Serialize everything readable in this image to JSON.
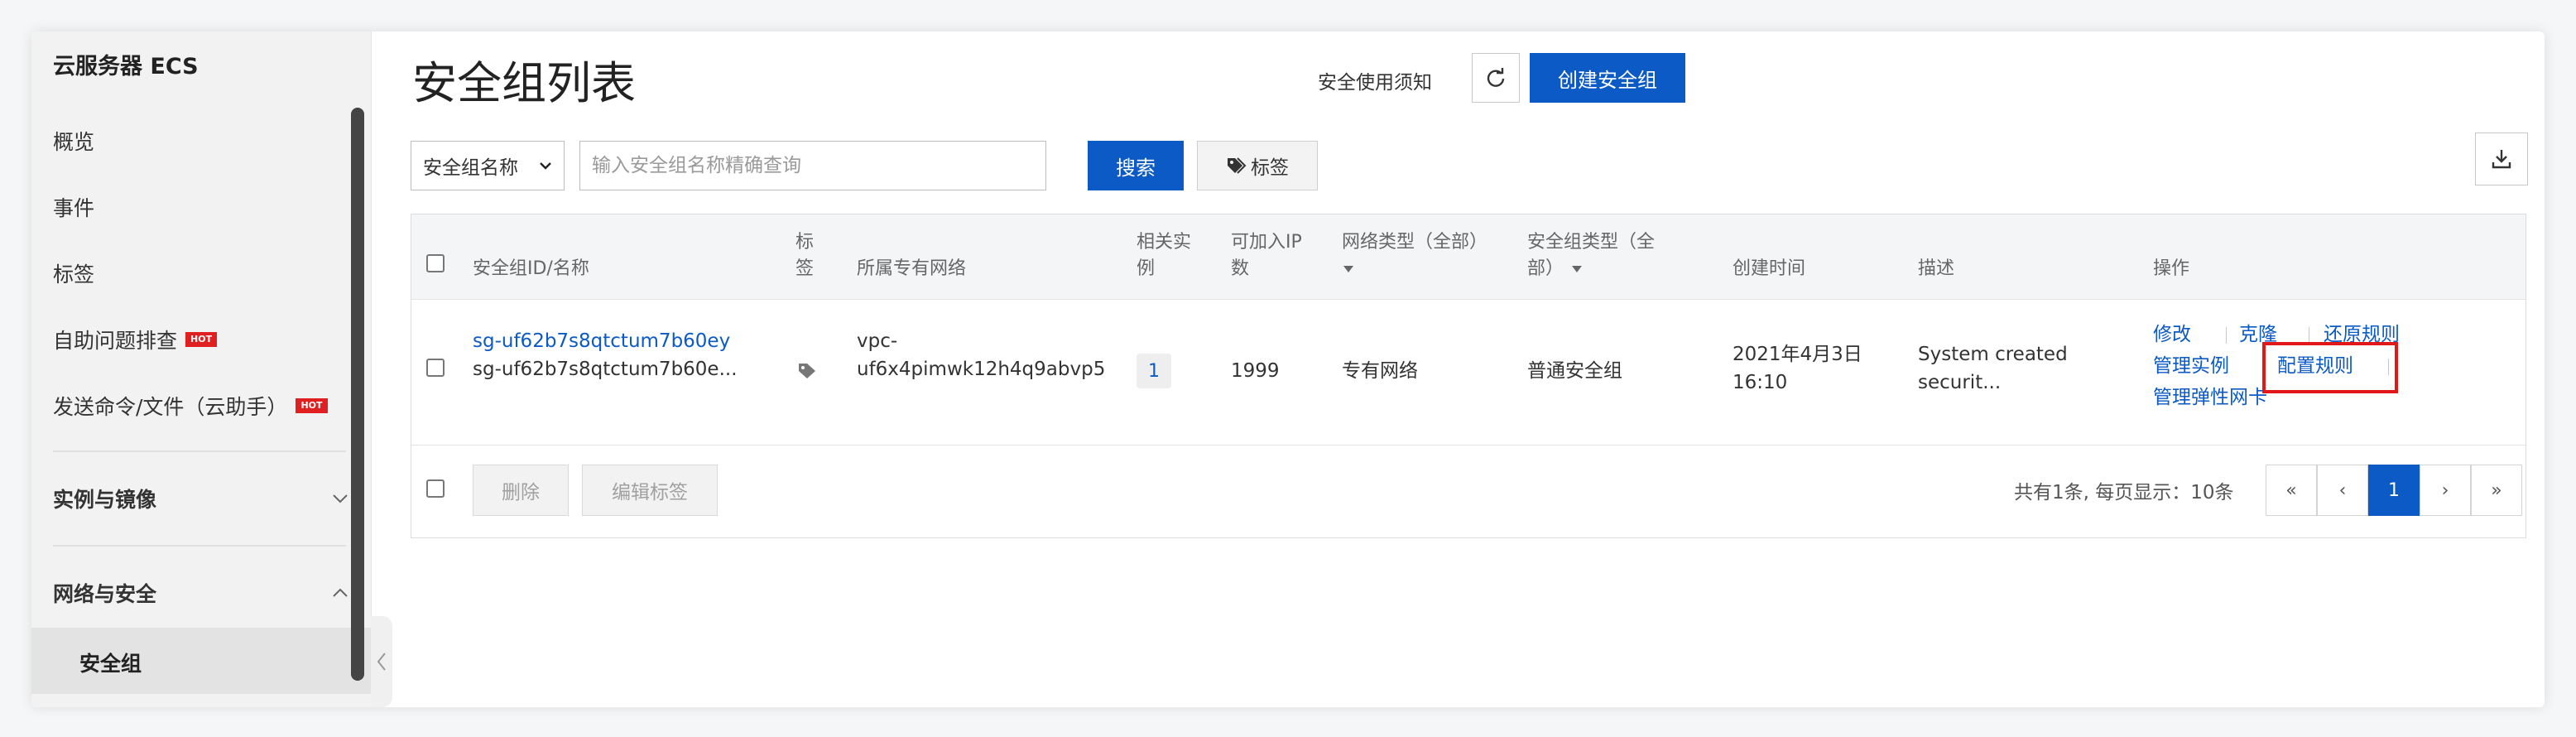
{
  "sidebar": {
    "title": "云服务器 ECS",
    "items": [
      {
        "label": "概览"
      },
      {
        "label": "事件"
      },
      {
        "label": "标签"
      },
      {
        "label": "自助问题排查",
        "badge": "HOT"
      },
      {
        "label": "发送命令/文件（云助手）",
        "badge": "HOT"
      }
    ],
    "groups": [
      {
        "label": "实例与镜像",
        "expanded": false
      },
      {
        "label": "网络与安全",
        "expanded": true
      }
    ],
    "active_item": "安全组"
  },
  "header": {
    "title": "安全组列表",
    "notice_link": "安全使用须知",
    "refresh_icon": "refresh-icon",
    "create_button": "创建安全组",
    "download_icon": "download-icon"
  },
  "filter": {
    "select_value": "安全组名称",
    "search_placeholder": "输入安全组名称精确查询",
    "search_button": "搜索",
    "tag_button": "标签"
  },
  "table": {
    "columns": {
      "id_name": "安全组ID/名称",
      "tag_1": "标",
      "tag_2": "签",
      "vpc": "所属专有网络",
      "related_1": "相关实",
      "related_2": "例",
      "ip_1": "可加入IP",
      "ip_2": "数",
      "net_type": "网络类型（全部）",
      "sg_type_1": "安全组类型（全",
      "sg_type_2": "部）",
      "created": "创建时间",
      "desc": "描述",
      "ops": "操作"
    },
    "rows": [
      {
        "id": "sg-uf62b7s8qtctum7b60ey",
        "name": "sg-uf62b7s8qtctum7b60e...",
        "vpc_1": "vpc-",
        "vpc_2": "uf6x4pimwk12h4q9abvp5",
        "related": "1",
        "ip_count": "1999",
        "net_type": "专有网络",
        "sg_type": "普通安全组",
        "created_date": "2021年4月3日",
        "created_time": "16:10",
        "desc_1": "System created",
        "desc_2": "securit...",
        "ops": {
          "modify": "修改",
          "clone": "克隆",
          "restore": "还原规则",
          "manage_instances": "管理实例",
          "config_rules": "配置规则",
          "manage_eni": "管理弹性网卡"
        }
      }
    ]
  },
  "footer": {
    "delete_button": "删除",
    "edit_tags_button": "编辑标签",
    "summary": "共有1条, 每页显示：10条",
    "pager": {
      "first": "«",
      "prev": "‹",
      "current": "1",
      "next": "›",
      "last": "»"
    }
  },
  "colors": {
    "primary": "#0b5ac6",
    "highlight": "#e01818",
    "hot": "#e02020"
  }
}
